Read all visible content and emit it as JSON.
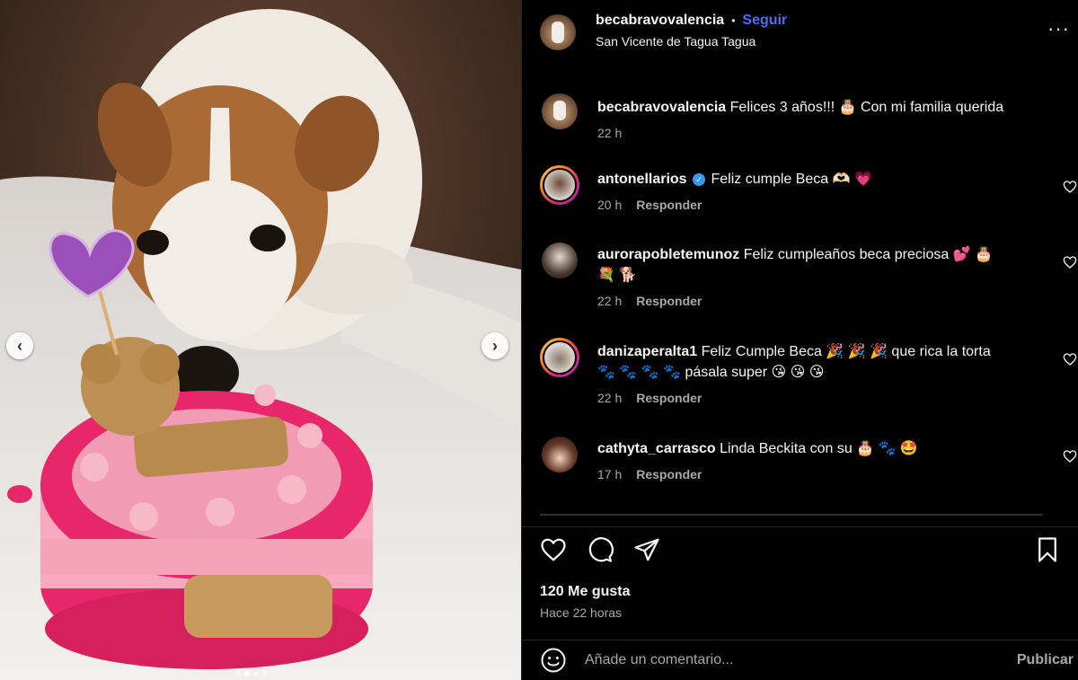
{
  "post": {
    "author": "becabravovalencia",
    "separator": "•",
    "follow_label": "Seguir",
    "location": "San Vicente de Tagua Tagua",
    "more_label": "···",
    "caption": {
      "user": "becabravovalencia",
      "text": "Felices 3 años!!! 🎂 Con mi familia querida",
      "time": "22 h"
    },
    "comments": [
      {
        "user": "antonellarios",
        "verified": true,
        "text": "Feliz cumple Beca 🫶🏻 💗",
        "time": "20 h",
        "reply": "Responder"
      },
      {
        "user": "aurorapobletemunoz",
        "verified": false,
        "text": "Feliz cumpleaños beca preciosa 💕 🎂",
        "text2": "💐 🐕",
        "time": "22 h",
        "reply": "Responder"
      },
      {
        "user": "danizaperalta1",
        "verified": false,
        "text": "Feliz Cumple Beca 🎉 🎉 🎉  que rica la torta",
        "text2": "🐾 🐾 🐾 🐾 pásala super 😘 😘 😘",
        "time": "22 h",
        "reply": "Responder"
      },
      {
        "user": "cathyta_carrasco",
        "verified": false,
        "text": "Linda Beckita con su 🎂 🐾 🤩",
        "time": "17 h",
        "reply": "Responder"
      }
    ],
    "likes": "120 Me gusta",
    "posted": "Hace 22 horas",
    "comment_placeholder": "Añade un comentario...",
    "publish_label": "Publicar"
  },
  "carousel": {
    "prev_label": "‹",
    "next_label": "›",
    "slides": 4,
    "active_slide": 2
  },
  "colors": {
    "background": "#000000",
    "text": "#f5f5f5",
    "muted": "#a8a8a8",
    "link": "#4f6df5",
    "divider": "#262626",
    "cake_pink": "#e8276a",
    "cake_light": "#f6a9bf"
  }
}
